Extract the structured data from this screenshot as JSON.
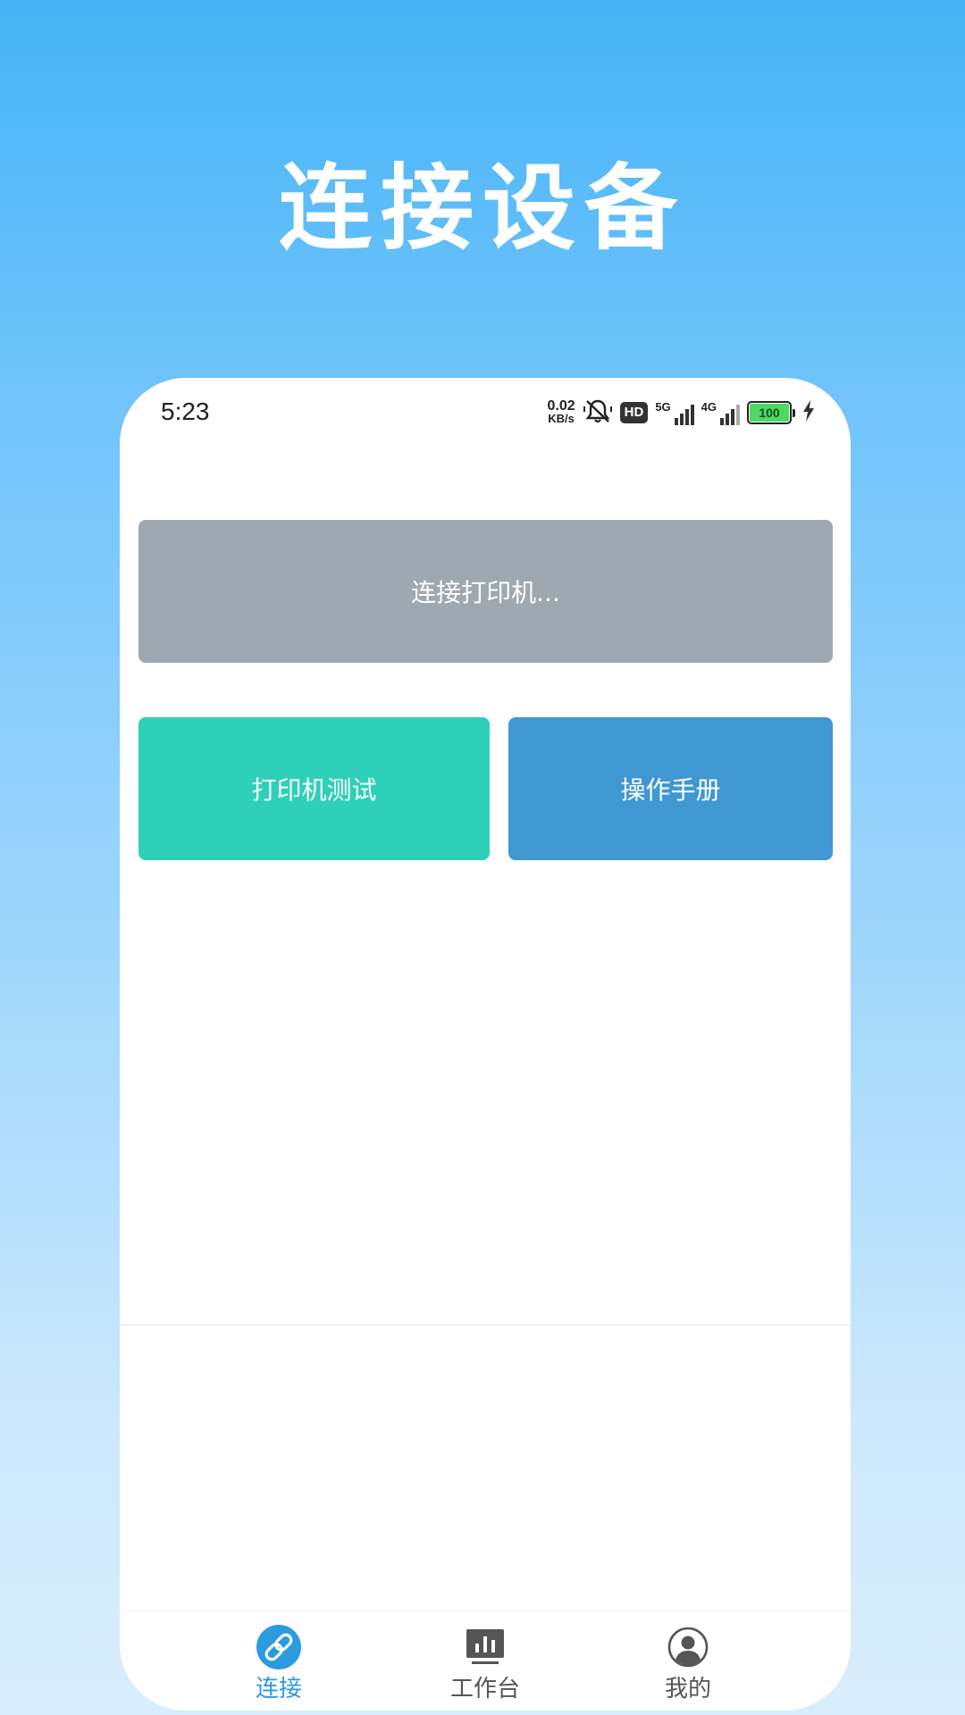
{
  "hero": {
    "title": "连接设备"
  },
  "status_bar": {
    "time": "5:23",
    "net_speed_value": "0.02",
    "net_speed_unit": "KB/s",
    "hd_label": "HD",
    "signal_1_label": "5G",
    "signal_2_label": "4G",
    "battery_level": "100"
  },
  "main": {
    "connect_button": "连接打印机...",
    "test_button": "打印机测试",
    "manual_button": "操作手册"
  },
  "tabbar": {
    "active_index": 0,
    "items": [
      {
        "label": "连接",
        "icon": "link-icon"
      },
      {
        "label": "工作台",
        "icon": "chart-board-icon"
      },
      {
        "label": "我的",
        "icon": "user-avatar-icon"
      }
    ]
  },
  "colors": {
    "connect_button": "#9ea8b0",
    "test_button": "#2ed0b7",
    "manual_button": "#4098d2",
    "tab_active": "#2b9be0",
    "tab_inactive": "#555555"
  }
}
